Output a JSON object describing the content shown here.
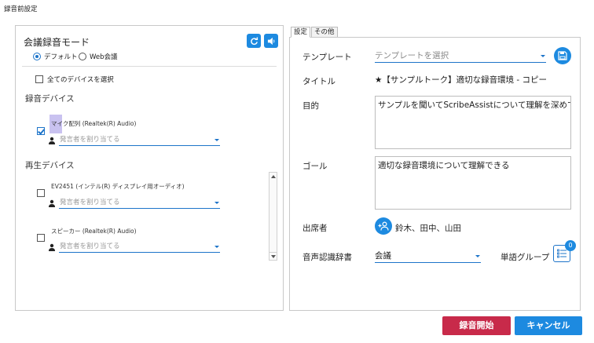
{
  "window": {
    "title": "録音前設定"
  },
  "left": {
    "mode_label": "会議録音モード",
    "radio_default": "デフォルト",
    "radio_web": "Web会議",
    "select_all": "全てのデバイスを選択",
    "recording_title": "録音デバイス",
    "recording_devices": [
      {
        "name": "マイク配列 (Realtek(R) Audio)",
        "checked": true,
        "assign_placeholder": "発言者を割り当てる"
      }
    ],
    "playback_title": "再生デバイス",
    "playback_devices": [
      {
        "name": "EV2451 (インテル(R) ディスプレイ用オーディオ)",
        "checked": false,
        "assign_placeholder": "発言者を割り当てる"
      },
      {
        "name": "スピーカー (Realtek(R) Audio)",
        "checked": false,
        "assign_placeholder": "発言者を割り当てる"
      }
    ]
  },
  "tabs": {
    "settings": "設定",
    "other": "その他"
  },
  "right": {
    "template_label": "テンプレート",
    "template_placeholder": "テンプレートを選択",
    "title_label": "タイトル",
    "title_value": "★【サンプルトーク】適切な録音環境 - コピー",
    "purpose_label": "目的",
    "purpose_value": "サンプルを聞いてScribeAssistについて理解を深めてもら",
    "goal_label": "ゴール",
    "goal_value": "適切な録音環境について理解できる",
    "attendees_label": "出席者",
    "attendees_value": "鈴木、田中、山田",
    "dictionary_label": "音声認識辞書",
    "dictionary_value": "会議",
    "word_group_label": "単語グループ",
    "word_group_count": "0"
  },
  "buttons": {
    "record": "録音開始",
    "cancel": "キャンセル"
  },
  "colors": {
    "accent": "#1d8ae0",
    "record": "#c82a4a"
  }
}
